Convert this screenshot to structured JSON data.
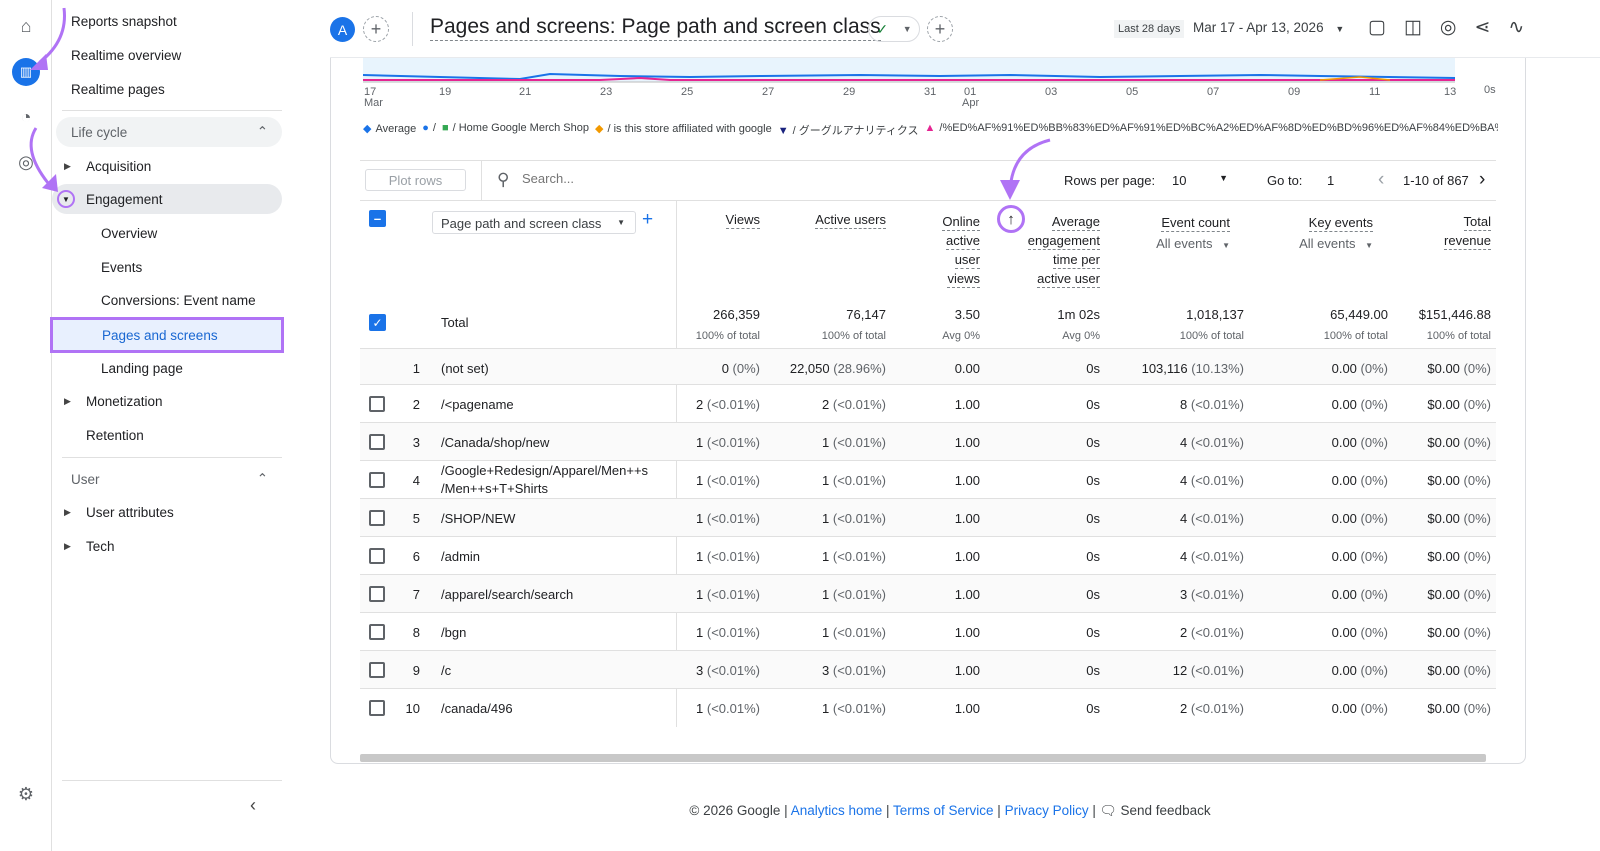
{
  "header": {
    "avatar": "A",
    "title": "Pages and screens: Page path and screen class",
    "date_chip": "Last 28 days",
    "date_range": "Mar 17 - Apr 13, 2026"
  },
  "sidebar": {
    "items": [
      {
        "label": "Reports snapshot"
      },
      {
        "label": "Realtime overview"
      },
      {
        "label": "Realtime pages"
      },
      {
        "label": "Life cycle"
      },
      {
        "label": "Acquisition"
      },
      {
        "label": "Engagement"
      },
      {
        "label": "Overview"
      },
      {
        "label": "Events"
      },
      {
        "label": "Conversions: Event name"
      },
      {
        "label": "Pages and screens"
      },
      {
        "label": "Landing page"
      },
      {
        "label": "Monetization"
      },
      {
        "label": "Retention"
      },
      {
        "label": "User"
      },
      {
        "label": "User attributes"
      },
      {
        "label": "Tech"
      }
    ]
  },
  "chart": {
    "x_ticks": [
      "17",
      "19",
      "21",
      "23",
      "25",
      "27",
      "29",
      "31",
      "01",
      "03",
      "05",
      "07",
      "09",
      "11",
      "13"
    ],
    "month_labels": {
      "Mar": "Mar",
      "Apr": "Apr"
    },
    "y_right": "0s",
    "legend": [
      {
        "label": "Average",
        "color": "#1a73e8"
      },
      {
        "label": "/",
        "color": "#1a73e8"
      },
      {
        "label": "/ Home Google Merch Shop",
        "color": "#34a853"
      },
      {
        "label": "/ is this store affiliated with google",
        "color": "#f29900"
      },
      {
        "label": "/ グーグルアナリティクス",
        "color": "#1a237e"
      },
      {
        "label": "/%ED%AF%91%ED%BB%83%ED%AF%91%ED%BC%A2%ED%AF%8D%ED%BD%96%ED%AF%84%ED%BA%",
        "color": "#e52592"
      }
    ]
  },
  "toolbar": {
    "plot_rows": "Plot rows",
    "search_placeholder": "Search...",
    "rows_per_page_label": "Rows per page:",
    "rows_per_page": "10",
    "goto_label": "Go to:",
    "goto": "1",
    "range": "1-10 of 867"
  },
  "table": {
    "dimension": "Page path and screen class",
    "headers": {
      "views": "Views",
      "active_users": "Active users",
      "online": [
        "Online",
        "active",
        "user",
        "views"
      ],
      "avg": [
        "Average",
        "engagement",
        "time per",
        "active user"
      ],
      "event_count": "Event count",
      "event_sub": "All events",
      "key_events": "Key events",
      "key_sub": "All events",
      "revenue": [
        "Total",
        "revenue"
      ]
    },
    "total": {
      "label": "Total",
      "views": "266,359",
      "views_sub": "100% of total",
      "users": "76,147",
      "users_sub": "100% of total",
      "online": "3.50",
      "online_sub": "Avg 0%",
      "avg": "1m 02s",
      "avg_sub": "Avg 0%",
      "events": "1,018,137",
      "events_sub": "100% of total",
      "key": "65,449.00",
      "key_sub": "100% of total",
      "rev": "$151,446.88",
      "rev_sub": "100% of total"
    },
    "rows": [
      {
        "n": "1",
        "path": "(not set)",
        "v": "0",
        "vp": "(0%)",
        "u": "22,050",
        "up": "(28.96%)",
        "o": "0.00",
        "a": "0s",
        "e": "103,116",
        "ep": "(10.13%)",
        "k": "0.00",
        "kp": "(0%)",
        "r": "$0.00",
        "rp": "(0%)"
      },
      {
        "n": "2",
        "path": "/<pagename",
        "v": "2",
        "vp": "(<0.01%)",
        "u": "2",
        "up": "(<0.01%)",
        "o": "1.00",
        "a": "0s",
        "e": "8",
        "ep": "(<0.01%)",
        "k": "0.00",
        "kp": "(0%)",
        "r": "$0.00",
        "rp": "(0%)"
      },
      {
        "n": "3",
        "path": "/Canada/shop/new",
        "v": "1",
        "vp": "(<0.01%)",
        "u": "1",
        "up": "(<0.01%)",
        "o": "1.00",
        "a": "0s",
        "e": "4",
        "ep": "(<0.01%)",
        "k": "0.00",
        "kp": "(0%)",
        "r": "$0.00",
        "rp": "(0%)"
      },
      {
        "n": "4",
        "path": "/Google+Redesign/Apparel/Men++s",
        "path2": "/Men++s+T+Shirts",
        "v": "1",
        "vp": "(<0.01%)",
        "u": "1",
        "up": "(<0.01%)",
        "o": "1.00",
        "a": "0s",
        "e": "4",
        "ep": "(<0.01%)",
        "k": "0.00",
        "kp": "(0%)",
        "r": "$0.00",
        "rp": "(0%)"
      },
      {
        "n": "5",
        "path": "/SHOP/NEW",
        "v": "1",
        "vp": "(<0.01%)",
        "u": "1",
        "up": "(<0.01%)",
        "o": "1.00",
        "a": "0s",
        "e": "4",
        "ep": "(<0.01%)",
        "k": "0.00",
        "kp": "(0%)",
        "r": "$0.00",
        "rp": "(0%)"
      },
      {
        "n": "6",
        "path": "/admin",
        "v": "1",
        "vp": "(<0.01%)",
        "u": "1",
        "up": "(<0.01%)",
        "o": "1.00",
        "a": "0s",
        "e": "4",
        "ep": "(<0.01%)",
        "k": "0.00",
        "kp": "(0%)",
        "r": "$0.00",
        "rp": "(0%)"
      },
      {
        "n": "7",
        "path": "/apparel/search/search",
        "v": "1",
        "vp": "(<0.01%)",
        "u": "1",
        "up": "(<0.01%)",
        "o": "1.00",
        "a": "0s",
        "e": "3",
        "ep": "(<0.01%)",
        "k": "0.00",
        "kp": "(0%)",
        "r": "$0.00",
        "rp": "(0%)"
      },
      {
        "n": "8",
        "path": "/bgn",
        "v": "1",
        "vp": "(<0.01%)",
        "u": "1",
        "up": "(<0.01%)",
        "o": "1.00",
        "a": "0s",
        "e": "2",
        "ep": "(<0.01%)",
        "k": "0.00",
        "kp": "(0%)",
        "r": "$0.00",
        "rp": "(0%)"
      },
      {
        "n": "9",
        "path": "/c",
        "v": "3",
        "vp": "(<0.01%)",
        "u": "3",
        "up": "(<0.01%)",
        "o": "1.00",
        "a": "0s",
        "e": "12",
        "ep": "(<0.01%)",
        "k": "0.00",
        "kp": "(0%)",
        "r": "$0.00",
        "rp": "(0%)"
      },
      {
        "n": "10",
        "path": "/canada/496",
        "v": "1",
        "vp": "(<0.01%)",
        "u": "1",
        "up": "(<0.01%)",
        "o": "1.00",
        "a": "0s",
        "e": "2",
        "ep": "(<0.01%)",
        "k": "0.00",
        "kp": "(0%)",
        "r": "$0.00",
        "rp": "(0%)"
      }
    ]
  },
  "footer": {
    "copyright": "© 2026 Google |",
    "analytics_home": "Analytics home",
    "terms": "Terms of Service",
    "privacy": "Privacy Policy",
    "feedback": "Send feedback"
  },
  "colors": {
    "accent": "#1a73e8",
    "annotation": "#b073f5",
    "selected_bg": "#e8f0fe"
  }
}
